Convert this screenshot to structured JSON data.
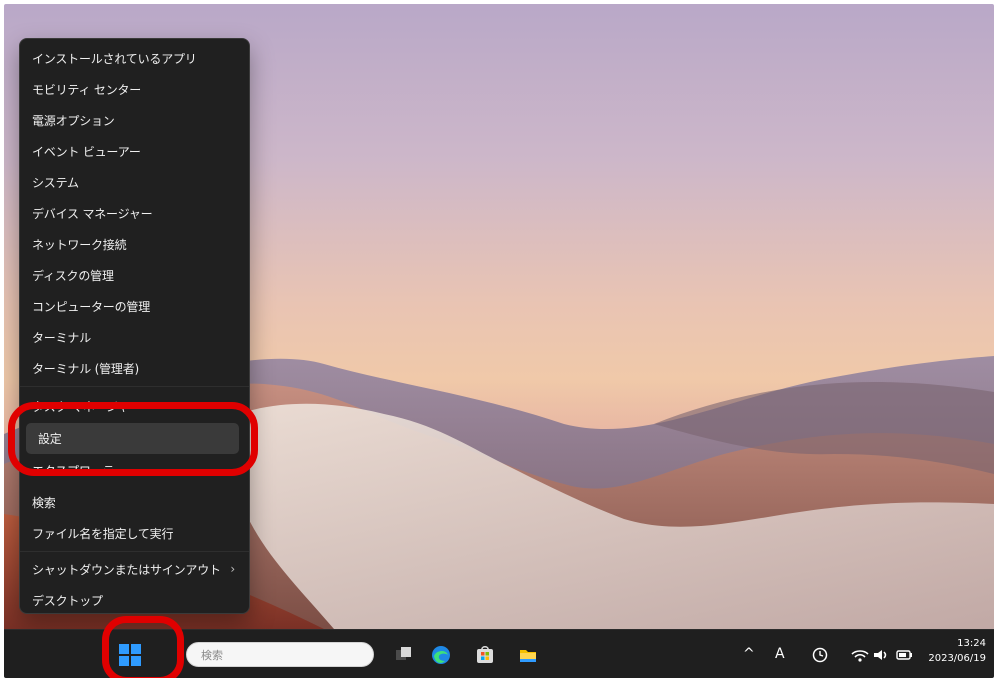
{
  "start_menu": {
    "items": [
      {
        "label": "インストールされているアプリ"
      },
      {
        "label": "モビリティ センター"
      },
      {
        "label": "電源オプション"
      },
      {
        "label": "イベント ビューアー"
      },
      {
        "label": "システム"
      },
      {
        "label": "デバイス マネージャー"
      },
      {
        "label": "ネットワーク接続"
      },
      {
        "label": "ディスクの管理"
      },
      {
        "label": "コンピューターの管理"
      },
      {
        "label": "ターミナル"
      },
      {
        "label": "ターミナル (管理者)"
      },
      {
        "label": "タスク マネージャー"
      },
      {
        "label": "設定"
      },
      {
        "label": "エクスプローラー"
      },
      {
        "label": "検索"
      },
      {
        "label": "ファイル名を指定して実行"
      },
      {
        "label": "シャットダウンまたはサインアウト"
      },
      {
        "label": "デスクトップ"
      }
    ],
    "submenu_chevron": "›"
  },
  "taskbar": {
    "search": {
      "placeholder": "検索"
    },
    "tray": {
      "overflow_icon": "^",
      "ime_mode": "A"
    },
    "clock": {
      "time": "13:24",
      "date": "2023/06/19"
    },
    "icons": [
      "windows-start-icon",
      "task-view-icon",
      "edge-icon",
      "store-icon",
      "file-explorer-icon",
      "language-icon",
      "wifi-icon",
      "volume-icon",
      "battery-icon"
    ]
  },
  "colors": {
    "highlight": "#e00000",
    "menu_bg": "#202020",
    "taskbar_bg": "#1f1f1f",
    "windows_blue": "#2f9bff"
  }
}
